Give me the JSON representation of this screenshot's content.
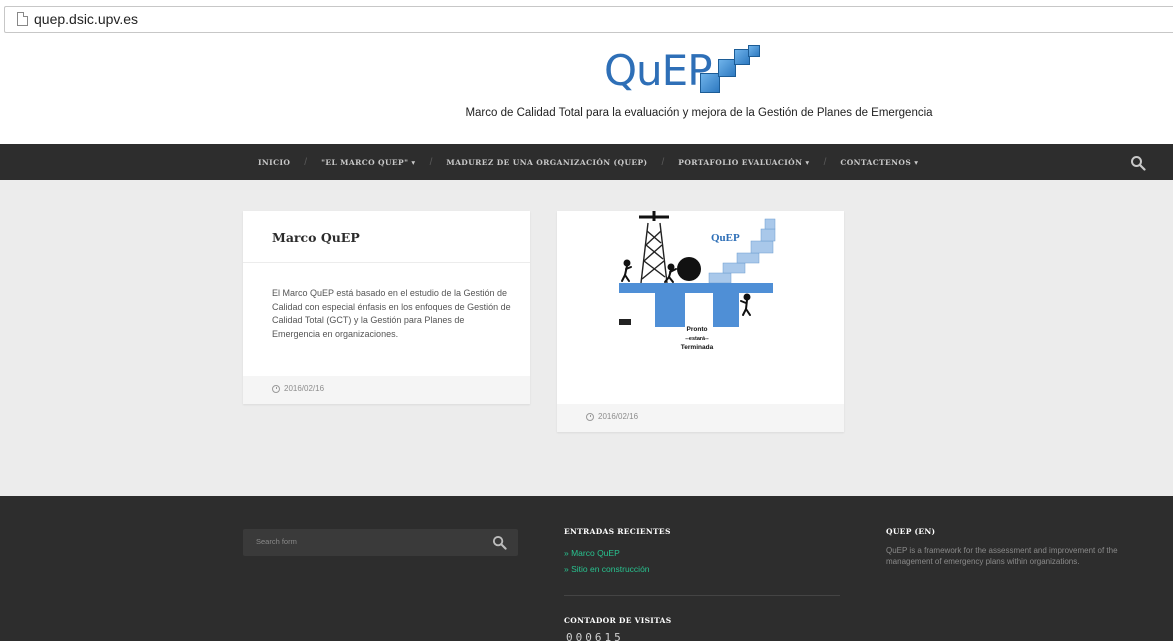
{
  "browser": {
    "url": "quep.dsic.upv.es"
  },
  "header": {
    "logo_text": "QuEP",
    "tagline": "Marco de Calidad Total para la evaluación y mejora de la Gestión de Planes de Emergencia"
  },
  "nav": {
    "items": [
      {
        "label": "INICIO",
        "has_dropdown": false
      },
      {
        "label": "\"EL MARCO QUEP\"",
        "has_dropdown": true
      },
      {
        "label": "MADUREZ DE UNA ORGANIZACIÓN (QUEP)",
        "has_dropdown": false
      },
      {
        "label": "PORTAFOLIO EVALUACIÓN",
        "has_dropdown": true
      },
      {
        "label": "CONTACTENOS",
        "has_dropdown": true
      }
    ],
    "dropdown_glyph": "▾",
    "separator": "/"
  },
  "posts": [
    {
      "title": "Marco QuEP",
      "excerpt": "El Marco QuEP está basado en el estudio de la Gestión de Calidad con especial énfasis en los enfoques de Gestión de Calidad Total (GCT) y la Gestión para Planes de Emergencia en organizaciones.",
      "date": "2016/02/16"
    },
    {
      "image_label": "QuEP",
      "image_caption_1": "Pronto",
      "image_caption_2": "--estará--",
      "image_caption_3": "Terminada",
      "date": "2016/02/16"
    }
  ],
  "footer": {
    "search_placeholder": "Search form",
    "recent_title": "ENTRADAS RECIENTES",
    "recent_items": [
      "» Marco QuEP",
      "» Sitio en construcción"
    ],
    "counter_title": "CONTADOR DE VISITAS",
    "counter_value": "000615",
    "about_title": "QUEP (EN)",
    "about_text": "QuEP is a framework for the assessment and improvement of the management of emergency plans within organizations."
  },
  "colors": {
    "nav_bg": "#2d2d2d",
    "accent_green": "#28c28f",
    "logo_blue": "#2e6fb7",
    "page_bg": "#ececec"
  }
}
